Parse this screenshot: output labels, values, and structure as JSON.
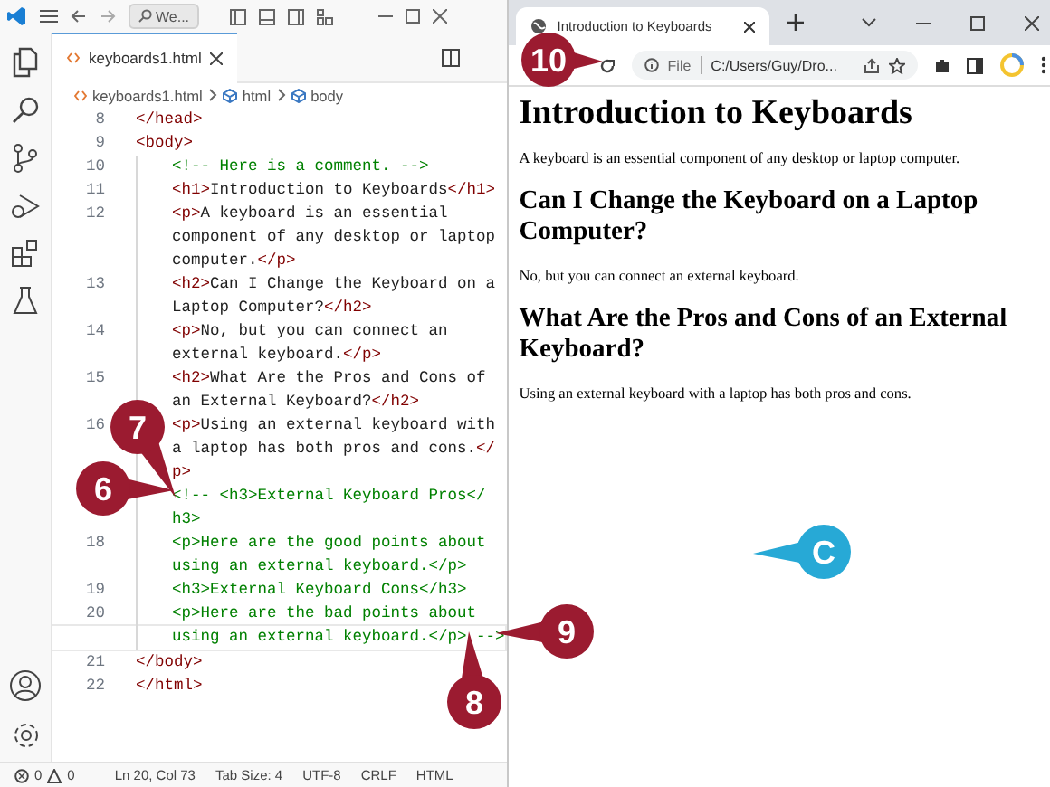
{
  "editor": {
    "search": "We...",
    "tab": "keyboards1.html",
    "breadcrumb": [
      "keyboards1.html",
      "html",
      "body"
    ],
    "code_lines": [
      {
        "number": "8",
        "current": false,
        "rows": [
          [
            {
              "kind": "tag",
              "text": "</head>"
            }
          ]
        ]
      },
      {
        "number": "9",
        "current": false,
        "rows": [
          [
            {
              "kind": "tag",
              "text": "<body>"
            }
          ]
        ],
        "children": [
          {
            "number": "10",
            "current": false,
            "rows": [
              [
                {
                  "kind": "comment",
                  "text": "<!-- Here is a comment. -->"
                }
              ]
            ]
          },
          {
            "number": "11",
            "current": false,
            "rows": [
              [
                {
                  "kind": "tag",
                  "text": "<h1>"
                },
                {
                  "kind": "text",
                  "text": "Introduction to Keyboards"
                },
                {
                  "kind": "tag",
                  "text": "</h1>"
                }
              ]
            ]
          },
          {
            "number": "12",
            "current": false,
            "rows": [
              [
                {
                  "kind": "tag",
                  "text": "<p>"
                },
                {
                  "kind": "text",
                  "text": "A keyboard is an essential"
                }
              ],
              [
                {
                  "kind": "text",
                  "text": "component of any desktop or laptop"
                }
              ],
              [
                {
                  "kind": "text",
                  "text": "computer."
                },
                {
                  "kind": "tag",
                  "text": "</p>"
                }
              ]
            ]
          },
          {
            "number": "13",
            "current": false,
            "rows": [
              [
                {
                  "kind": "tag",
                  "text": "<h2>"
                },
                {
                  "kind": "text",
                  "text": "Can I Change the Keyboard on a"
                }
              ],
              [
                {
                  "kind": "text",
                  "text": "Laptop Computer?"
                },
                {
                  "kind": "tag",
                  "text": "</h2>"
                }
              ]
            ]
          },
          {
            "number": "14",
            "current": false,
            "rows": [
              [
                {
                  "kind": "tag",
                  "text": "<p>"
                },
                {
                  "kind": "text",
                  "text": "No, but you can connect an"
                }
              ],
              [
                {
                  "kind": "text",
                  "text": "external keyboard."
                },
                {
                  "kind": "tag",
                  "text": "</p>"
                }
              ]
            ]
          },
          {
            "number": "15",
            "current": false,
            "rows": [
              [
                {
                  "kind": "tag",
                  "text": "<h2>"
                },
                {
                  "kind": "text",
                  "text": "What Are the Pros and Cons of"
                }
              ],
              [
                {
                  "kind": "text",
                  "text": "an External Keyboard?"
                },
                {
                  "kind": "tag",
                  "text": "</h2>"
                }
              ]
            ]
          },
          {
            "number": "16",
            "current": false,
            "rows": [
              [
                {
                  "kind": "tag",
                  "text": "<p>"
                },
                {
                  "kind": "text",
                  "text": "Using an external keyboard with"
                }
              ],
              [
                {
                  "kind": "text",
                  "text": "a laptop has both pros and cons."
                },
                {
                  "kind": "tag",
                  "text": "</"
                }
              ],
              [
                {
                  "kind": "tag",
                  "text": "p>"
                }
              ]
            ]
          },
          {
            "current": false,
            "rows": [
              [
                {
                  "kind": "comment",
                  "text": "<!-- <h3>External Keyboard Pros</"
                }
              ],
              [
                {
                  "kind": "comment",
                  "text": "h3>"
                }
              ]
            ]
          },
          {
            "number": "18",
            "current": false,
            "rows": [
              [
                {
                  "kind": "comment",
                  "text": "<p>Here are the good points about"
                }
              ],
              [
                {
                  "kind": "comment",
                  "text": "using an external keyboard.</p>"
                }
              ]
            ]
          },
          {
            "number": "19",
            "current": false,
            "rows": [
              [
                {
                  "kind": "comment",
                  "text": "<h3>External Keyboard Cons</h3>"
                }
              ]
            ]
          },
          {
            "number": "20",
            "current": true,
            "rows": [
              [
                {
                  "kind": "comment",
                  "text": "<p>Here are the bad points about"
                }
              ],
              [
                {
                  "kind": "comment",
                  "text": "using an external keyboard.</p> -->"
                }
              ]
            ]
          }
        ]
      },
      {
        "number": "21",
        "current": false,
        "rows": [
          [
            {
              "kind": "tag",
              "text": "</body>"
            }
          ]
        ]
      },
      {
        "number": "22",
        "current": false,
        "rows": [
          [
            {
              "kind": "tag",
              "text": "</html>"
            }
          ]
        ]
      }
    ],
    "status_bar": {
      "errors": "0",
      "warnings": "0",
      "items": [
        "Ln 20, Col 73",
        "Tab Size: 4",
        "UTF-8",
        "CRLF",
        "HTML"
      ]
    }
  },
  "browser": {
    "tab_title": "Introduction to Keyboards",
    "scheme": "File",
    "address": "C:/Users/Guy/Dro...",
    "page": [
      {
        "kind": "h1",
        "text": "Introduction to Keyboards"
      },
      {
        "kind": "p",
        "text": "A keyboard is an essential component of any desktop or laptop computer."
      },
      {
        "kind": "h2",
        "text": "Can I Change the Keyboard on a Laptop Computer?"
      },
      {
        "kind": "p",
        "text": "No, but you can connect an external keyboard."
      },
      {
        "kind": "h2",
        "text": "What Are the Pros and Cons of an External Keyboard?"
      },
      {
        "kind": "p",
        "text": "Using an external keyboard with a laptop has both pros and cons."
      }
    ]
  },
  "callouts": [
    {
      "label": "10",
      "color": "#9b1b30"
    },
    {
      "label": "7",
      "color": "#9b1b30"
    },
    {
      "label": "6",
      "color": "#9b1b30"
    },
    {
      "label": "9",
      "color": "#9b1b30"
    },
    {
      "label": "C",
      "color": "#27a9d6"
    },
    {
      "label": "8",
      "color": "#9b1b30"
    }
  ]
}
